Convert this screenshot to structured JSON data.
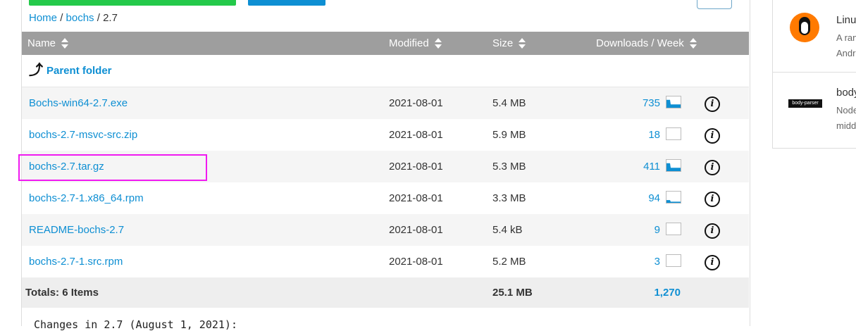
{
  "breadcrumb": {
    "home": "Home",
    "sep1": "/",
    "project": "bochs",
    "sep2": "/",
    "current": "2.7"
  },
  "table": {
    "headers": {
      "name": "Name",
      "modified": "Modified",
      "size": "Size",
      "downloads": "Downloads / Week"
    },
    "parent": "Parent folder",
    "rows": [
      {
        "name": "Bochs-win64-2.7.exe",
        "modified": "2021-08-01",
        "size": "5.4 MB",
        "downloads": "735"
      },
      {
        "name": "bochs-2.7-msvc-src.zip",
        "modified": "2021-08-01",
        "size": "5.9 MB",
        "downloads": "18"
      },
      {
        "name": "bochs-2.7.tar.gz",
        "modified": "2021-08-01",
        "size": "5.3 MB",
        "downloads": "411"
      },
      {
        "name": "bochs-2.7-1.x86_64.rpm",
        "modified": "2021-08-01",
        "size": "3.3 MB",
        "downloads": "94"
      },
      {
        "name": "README-bochs-2.7",
        "modified": "2021-08-01",
        "size": "5.4 kB",
        "downloads": "9"
      },
      {
        "name": "bochs-2.7-1.src.rpm",
        "modified": "2021-08-01",
        "size": "5.2 MB",
        "downloads": "3"
      }
    ],
    "totals": {
      "label": "Totals: 6 Items",
      "size": "25.1 MB",
      "downloads": "1,270"
    }
  },
  "changes_text": "Changes in 2.7 (August 1, 2021):",
  "sidebar": {
    "items": [
      {
        "title": "Linu",
        "desc_1": "A ran",
        "desc_2": "Andr"
      },
      {
        "title": "body",
        "logo_text": "body-parser",
        "desc_1": "Node",
        "desc_2": "midd"
      }
    ]
  },
  "icons": [
    "parent-folder-arrow-icon",
    "sort-icon",
    "sparkline-icon",
    "info-icon",
    "penguin-icon"
  ],
  "colors": {
    "link": "#0e8fd3",
    "header": "#9e9e9e",
    "highlight": "#f01af0",
    "green_button": "#24c94a"
  }
}
